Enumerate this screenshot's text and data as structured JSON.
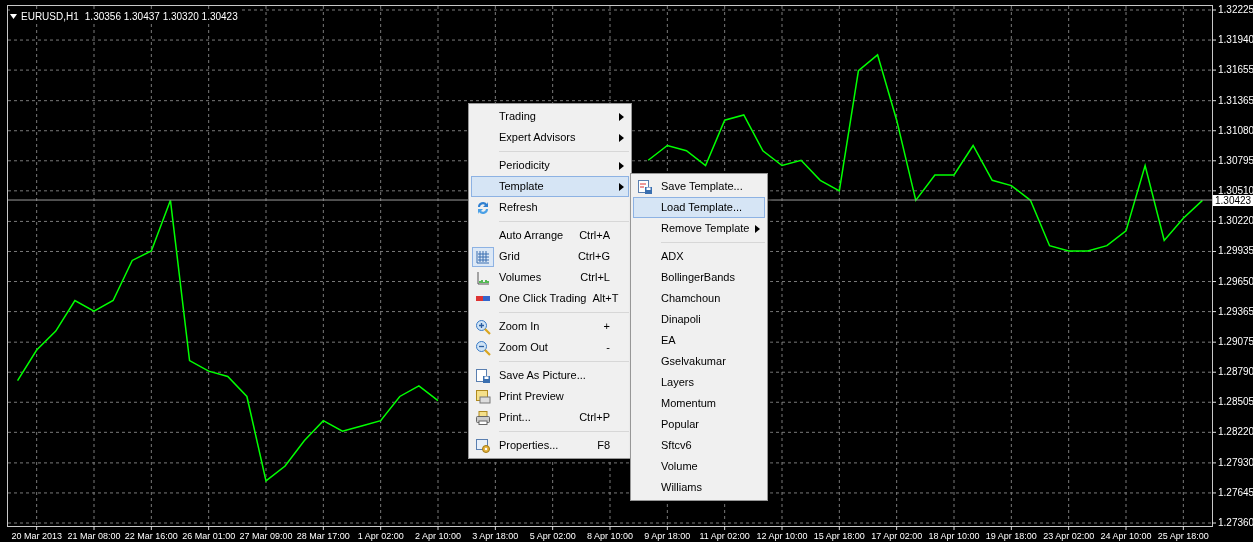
{
  "chart": {
    "quote": "1.30356 1.30437 1.30320 1.30423",
    "current_price": "1.30423",
    "chart_data": {
      "type": "line",
      "title": "EURUSD,H1",
      "grid": true,
      "ylim": [
        1.2736,
        1.32225
      ],
      "categories": [
        null,
        "20 Mar 2013",
        null,
        null,
        "21 Mar 08:00",
        null,
        null,
        "22 Mar 16:00",
        null,
        null,
        "26 Mar 01:00",
        null,
        null,
        "27 Mar 09:00",
        null,
        null,
        "28 Mar 17:00",
        null,
        null,
        "1 Apr 02:00",
        null,
        null,
        "2 Apr 10:00",
        null,
        null,
        "3 Apr 18:00",
        null,
        null,
        "5 Apr 02:00",
        null,
        null,
        "8 Apr 10:00",
        null,
        null,
        "9 Apr 18:00",
        null,
        null,
        "11 Apr 02:00",
        null,
        null,
        "12 Apr 10:00",
        null,
        null,
        "15 Apr 18:00",
        null,
        null,
        "17 Apr 02:00",
        null,
        null,
        "18 Apr 10:00",
        null,
        null,
        "19 Apr 18:00",
        null,
        null,
        "23 Apr 02:00",
        null,
        null,
        "24 Apr 10:00",
        null,
        null,
        "25 Apr 18:00",
        null
      ],
      "series": [
        {
          "color": "#00ff00",
          "values": [
            1.2871,
            1.29,
            1.2918,
            1.2947,
            1.2937,
            1.2947,
            1.2985,
            1.2994,
            1.3042,
            1.289,
            1.288,
            1.2875,
            1.2856,
            1.2776,
            1.279,
            1.2814,
            1.2833,
            1.2823,
            1.2828,
            1.2833,
            1.2856,
            1.2866,
            1.2852,
            null,
            null,
            null,
            null,
            null,
            null,
            null,
            null,
            null,
            null,
            1.308,
            1.3094,
            1.3089,
            1.3075,
            1.3118,
            1.3123,
            1.3089,
            1.3075,
            1.308,
            1.3061,
            1.3051,
            1.3165,
            1.318,
            1.3118,
            1.3042,
            1.3066,
            1.3066,
            1.3094,
            1.3061,
            1.3056,
            1.3042,
            1.2999,
            1.2994,
            1.2994,
            1.2999,
            1.3013,
            1.3075,
            1.3004,
            1.3025,
            1.3042
          ]
        }
      ],
      "yticks": [
        {
          "value": 1.32225,
          "label": "1.32225"
        },
        {
          "value": 1.3194,
          "label": "1.31940"
        },
        {
          "value": 1.31655,
          "label": "1.31655"
        },
        {
          "value": 1.31365,
          "label": "1.31365"
        },
        {
          "value": 1.3108,
          "label": "1.31080"
        },
        {
          "value": 1.30795,
          "label": "1.30795"
        },
        {
          "value": 1.3051,
          "label": "1.30510"
        },
        {
          "value": 1.3022,
          "label": "1.30220"
        },
        {
          "value": 1.29935,
          "label": "1.29935"
        },
        {
          "value": 1.2965,
          "label": "1.29650"
        },
        {
          "value": 1.29365,
          "label": "1.29365"
        },
        {
          "value": 1.29075,
          "label": "1.29075"
        },
        {
          "value": 1.2879,
          "label": "1.28790"
        },
        {
          "value": 1.28505,
          "label": "1.28505"
        },
        {
          "value": 1.2822,
          "label": "1.28220"
        },
        {
          "value": 1.2793,
          "label": "1.27930"
        },
        {
          "value": 1.27645,
          "label": "1.27645"
        },
        {
          "value": 1.2736,
          "label": "1.27360"
        }
      ]
    }
  },
  "context_menu": {
    "items": [
      {
        "kind": "item",
        "label": "Trading",
        "submenu": true,
        "selected": false,
        "checked": false
      },
      {
        "kind": "item",
        "label": "Expert Advisors",
        "submenu": true,
        "selected": false,
        "checked": false
      },
      {
        "kind": "separator"
      },
      {
        "kind": "item",
        "label": "Periodicity",
        "submenu": true,
        "selected": false,
        "checked": false
      },
      {
        "kind": "item",
        "label": "Template",
        "submenu": true,
        "selected": true,
        "checked": false
      },
      {
        "kind": "item",
        "label": "Refresh",
        "submenu": false,
        "selected": false,
        "checked": false
      },
      {
        "kind": "separator"
      },
      {
        "kind": "item",
        "label": "Auto Arrange",
        "shortcut": "Ctrl+A",
        "submenu": false,
        "selected": false,
        "checked": false
      },
      {
        "kind": "item",
        "label": "Grid",
        "shortcut": "Ctrl+G",
        "submenu": false,
        "selected": false,
        "checked": true
      },
      {
        "kind": "item",
        "label": "Volumes",
        "shortcut": "Ctrl+L",
        "submenu": false,
        "selected": false,
        "checked": false
      },
      {
        "kind": "item",
        "label": "One Click Trading",
        "shortcut": "Alt+T",
        "submenu": false,
        "selected": false,
        "checked": false
      },
      {
        "kind": "separator"
      },
      {
        "kind": "item",
        "label": "Zoom In",
        "shortcut": "+",
        "submenu": false,
        "selected": false,
        "checked": false
      },
      {
        "kind": "item",
        "label": "Zoom Out",
        "shortcut": "-",
        "submenu": false,
        "selected": false,
        "checked": false
      },
      {
        "kind": "separator"
      },
      {
        "kind": "item",
        "label": "Save As Picture...",
        "submenu": false,
        "selected": false,
        "checked": false
      },
      {
        "kind": "item",
        "label": "Print Preview",
        "submenu": false,
        "selected": false,
        "checked": false
      },
      {
        "kind": "item",
        "label": "Print...",
        "shortcut": "Ctrl+P",
        "submenu": false,
        "selected": false,
        "checked": false
      },
      {
        "kind": "separator"
      },
      {
        "kind": "item",
        "label": "Properties...",
        "shortcut": "F8",
        "submenu": false,
        "selected": false,
        "checked": false
      }
    ]
  },
  "template_submenu": {
    "items": [
      {
        "kind": "item",
        "label": "Save Template...",
        "submenu": false,
        "selected": false
      },
      {
        "kind": "item",
        "label": "Load Template...",
        "submenu": false,
        "selected": true
      },
      {
        "kind": "item",
        "label": "Remove Template",
        "submenu": true,
        "selected": false
      },
      {
        "kind": "separator"
      },
      {
        "kind": "item",
        "label": "ADX",
        "submenu": false,
        "selected": false
      },
      {
        "kind": "item",
        "label": "BollingerBands",
        "submenu": false,
        "selected": false
      },
      {
        "kind": "item",
        "label": "Chamchoun",
        "submenu": false,
        "selected": false
      },
      {
        "kind": "item",
        "label": "Dinapoli",
        "submenu": false,
        "selected": false
      },
      {
        "kind": "item",
        "label": "EA",
        "submenu": false,
        "selected": false
      },
      {
        "kind": "item",
        "label": "Gselvakumar",
        "submenu": false,
        "selected": false
      },
      {
        "kind": "item",
        "label": "Layers",
        "submenu": false,
        "selected": false
      },
      {
        "kind": "item",
        "label": "Momentum",
        "submenu": false,
        "selected": false
      },
      {
        "kind": "item",
        "label": "Popular",
        "submenu": false,
        "selected": false
      },
      {
        "kind": "item",
        "label": "Sftcv6",
        "submenu": false,
        "selected": false
      },
      {
        "kind": "item",
        "label": "Volume",
        "submenu": false,
        "selected": false
      },
      {
        "kind": "item",
        "label": "Williams",
        "submenu": false,
        "selected": false
      }
    ]
  }
}
